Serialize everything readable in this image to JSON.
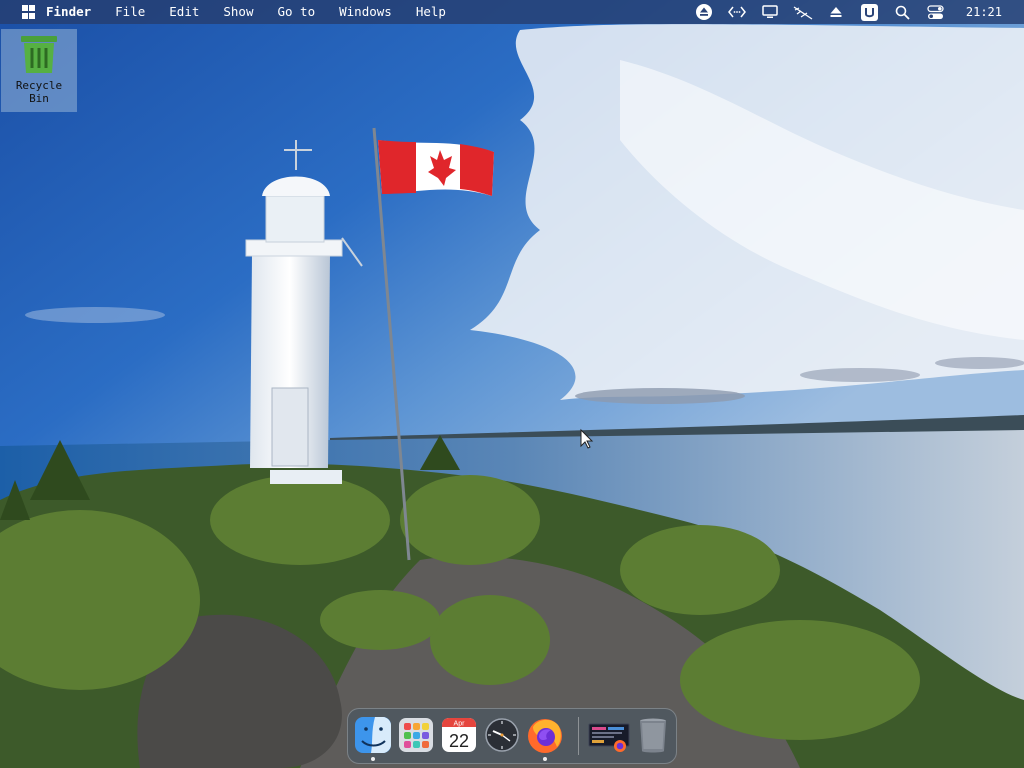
{
  "menubar": {
    "app_name": "Finder",
    "menus": [
      "File",
      "Edit",
      "Show",
      "Go to",
      "Windows",
      "Help"
    ],
    "clock": "21:21",
    "status_icons": [
      "eject-circle-icon",
      "code-arrows-icon",
      "monitor-icon",
      "network-off-icon",
      "eject-icon",
      "user-u-icon",
      "search-icon",
      "control-center-icon"
    ],
    "background": "#263e70"
  },
  "desktop": {
    "icons": [
      {
        "label": "Recycle Bin",
        "icon": "recycle-bin-icon"
      }
    ]
  },
  "dock": {
    "items": [
      {
        "name": "finder-icon",
        "running": true
      },
      {
        "name": "launchpad-icon",
        "running": false
      },
      {
        "name": "calendar-icon",
        "running": false,
        "month": "Apr",
        "day": "22"
      },
      {
        "name": "clock-icon",
        "running": false
      },
      {
        "name": "firefox-icon",
        "running": true
      },
      {
        "name": "window-thumbnail-icon",
        "running": false
      },
      {
        "name": "trash-icon",
        "running": false
      }
    ]
  }
}
